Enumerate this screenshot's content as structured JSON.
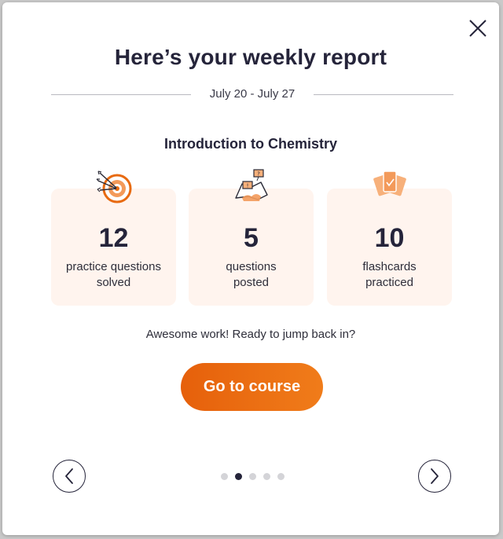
{
  "modal": {
    "title": "Here’s your weekly report",
    "date_range": "July 20 - July 27",
    "course": "Introduction to Chemistry",
    "stats": [
      {
        "value": "12",
        "label_line1": "practice questions",
        "label_line2": "solved",
        "icon": "target-icon"
      },
      {
        "value": "5",
        "label_line1": "questions",
        "label_line2": "posted",
        "icon": "question-map-icon"
      },
      {
        "value": "10",
        "label_line1": "flashcards",
        "label_line2": "practiced",
        "icon": "flashcards-icon"
      }
    ],
    "encouragement": "Awesome work! Ready to jump back in?",
    "cta_label": "Go to course",
    "pagination": {
      "total": 5,
      "active_index": 1
    }
  },
  "colors": {
    "accent": "#e86a10",
    "card_bg": "#fff4ee",
    "text_dark": "#25243a",
    "dot_inactive": "#d4d4d8"
  }
}
